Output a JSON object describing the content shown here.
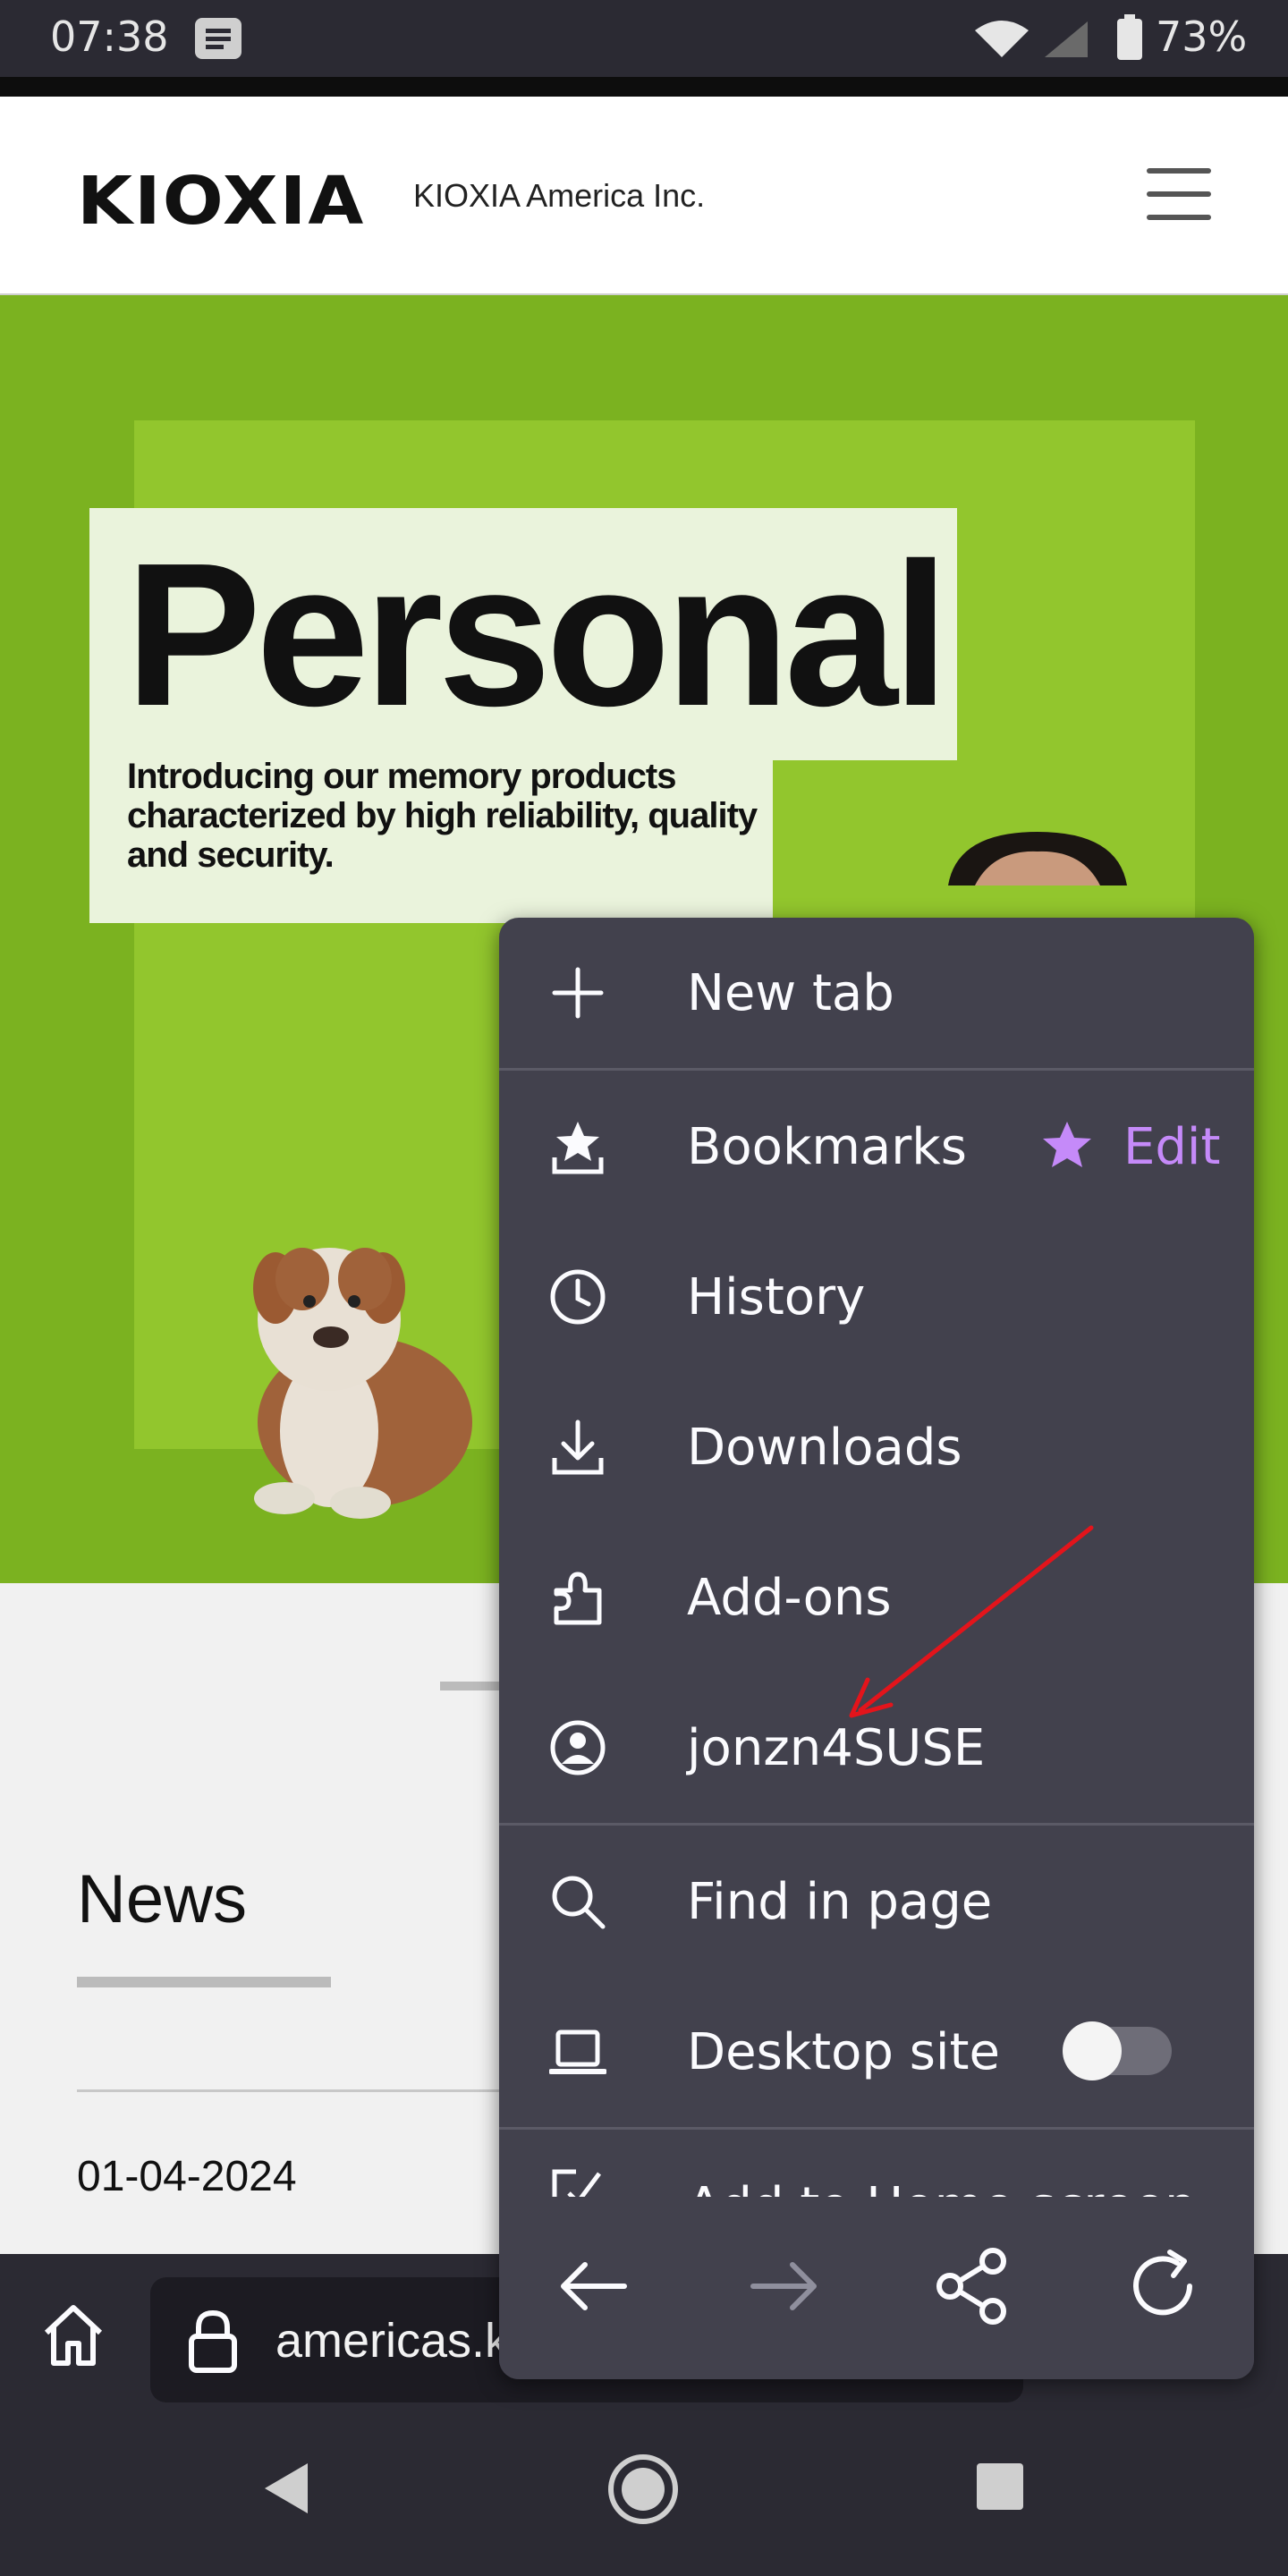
{
  "status_bar": {
    "time": "07:38",
    "battery": "73%"
  },
  "site_header": {
    "logo": "KIOXIA",
    "company": "KIOXIA America Inc."
  },
  "hero": {
    "headline": "Personal",
    "subtitle": "Introducing our memory products characterized by high reliability, quality and security."
  },
  "news": {
    "title": "News",
    "date": "01-04-2024"
  },
  "toolbar": {
    "url": "americas.kioxia.com"
  },
  "menu": {
    "items": [
      {
        "label": "New tab",
        "icon": "plus-icon"
      },
      {
        "label": "Bookmarks",
        "icon": "bookmarks-icon"
      },
      {
        "label": "History",
        "icon": "clock-icon"
      },
      {
        "label": "Downloads",
        "icon": "download-icon"
      },
      {
        "label": "Add-ons",
        "icon": "puzzle-icon"
      },
      {
        "label": "jonzn4SUSE",
        "icon": "account-icon"
      },
      {
        "label": "Find in page",
        "icon": "search-icon"
      },
      {
        "label": "Desktop site",
        "icon": "laptop-icon"
      },
      {
        "label": "Add to Home screen",
        "icon": "add-to-home-icon"
      }
    ],
    "bookmarks_edit": "Edit",
    "desktop_site_enabled": false,
    "accent_color": "#c58af9",
    "background_color": "#42414d"
  }
}
